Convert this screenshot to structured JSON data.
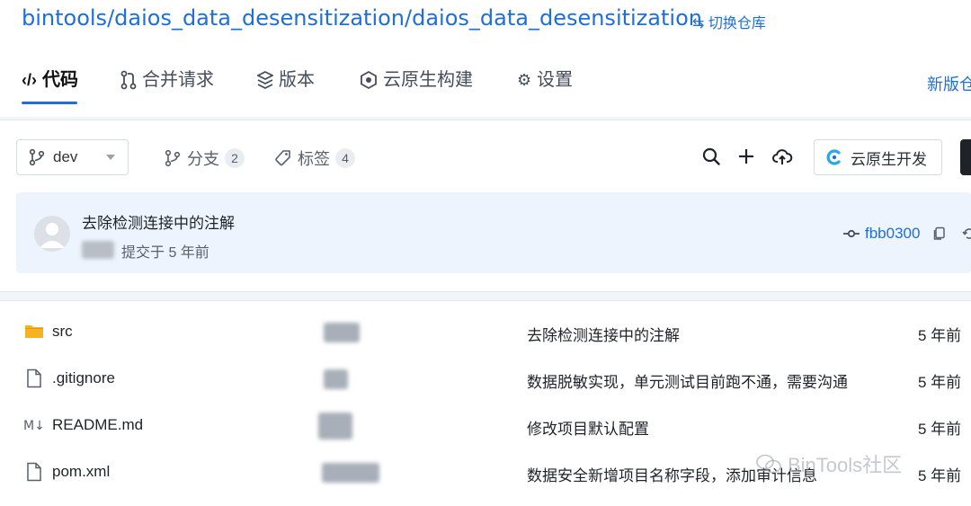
{
  "header": {
    "repo_path": "bintools/daios_data_desensitization/daios_data_desensitization",
    "switch_repo_label": "⇆ 切换仓库",
    "new_version_label": "新版仓"
  },
  "tabs": [
    {
      "icon": "code-icon",
      "label": "代码",
      "active": true
    },
    {
      "icon": "pull-request-icon",
      "label": "合并请求"
    },
    {
      "icon": "layers-icon",
      "label": "版本"
    },
    {
      "icon": "cloud-build-icon",
      "label": "云原生构建"
    },
    {
      "icon": "gear-icon",
      "label": "设置"
    }
  ],
  "toolbar": {
    "branch": "dev",
    "branches_label": "分支",
    "branches_count": "2",
    "tags_label": "标签",
    "tags_count": "4",
    "cloud_dev_label": "云原生开发"
  },
  "commit": {
    "message": "去除检测连接中的注解",
    "time": "提交于 5 年前",
    "hash": "fbb0300"
  },
  "files": [
    {
      "type": "folder",
      "icon": "folder-icon",
      "name": "src",
      "message": "去除检测连接中的注解",
      "time": "5 年前"
    },
    {
      "type": "file",
      "icon": "file-icon",
      "name": ".gitignore",
      "message": "数据脱敏实现，单元测试目前跑不通，需要沟通",
      "time": "5 年前"
    },
    {
      "type": "markdown",
      "icon": "markdown-icon",
      "name": "README.md",
      "message": "修改项目默认配置",
      "time": "5 年前"
    },
    {
      "type": "file",
      "icon": "file-icon",
      "name": "pom.xml",
      "message": "数据安全新增项目名称字段，添加审计信息",
      "time": "5 年前"
    }
  ],
  "watermark": "BinTools社区",
  "colors": {
    "accent": "#1e6fd9",
    "folder": "#f5b323",
    "commit_bg": "#eef4fd"
  }
}
